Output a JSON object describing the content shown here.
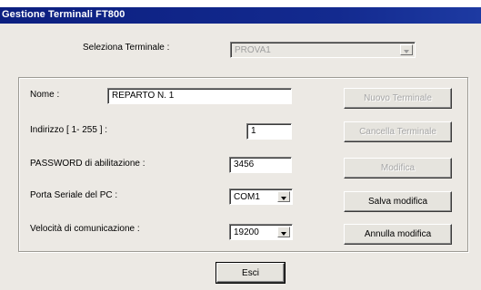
{
  "window": {
    "title": "Gestione Terminali FT800"
  },
  "selector": {
    "label": "Seleziona Terminale :",
    "value": "PROVA1"
  },
  "form": {
    "nome_label": "Nome :",
    "nome_value": "REPARTO  N. 1",
    "indirizzo_label": "Indirizzo [ 1- 255 ] :",
    "indirizzo_value": "1",
    "password_label": "PASSWORD di abilitazione :",
    "password_value": "3456",
    "porta_label": "Porta Seriale del PC :",
    "porta_value": "COM1",
    "velocita_label": "Velocità di comunicazione :",
    "velocita_value": "19200"
  },
  "buttons": {
    "nuovo": "Nuovo Terminale",
    "cancella": "Cancella Terminale",
    "modifica": "Modifica",
    "salva": "Salva modifica",
    "annulla": "Annulla modifica",
    "esci": "Esci"
  }
}
